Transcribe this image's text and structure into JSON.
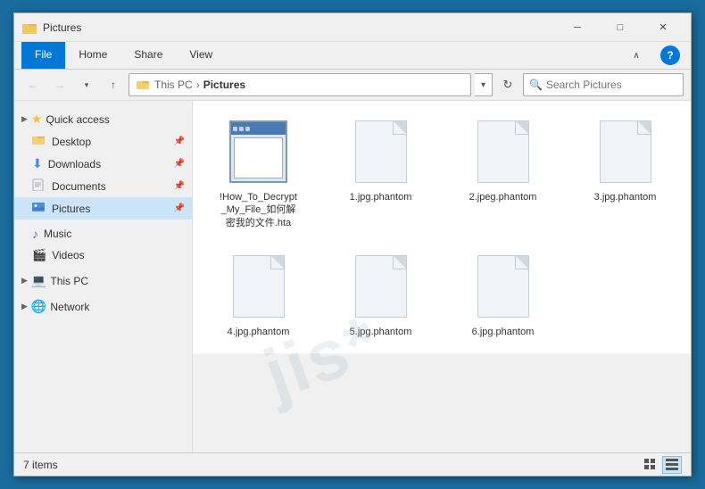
{
  "window": {
    "title": "Pictures",
    "icon": "📁"
  },
  "ribbon": {
    "tabs": [
      "File",
      "Home",
      "Share",
      "View"
    ],
    "active_tab": "File"
  },
  "address_bar": {
    "back_tooltip": "Back",
    "forward_tooltip": "Forward",
    "up_tooltip": "Up",
    "path": [
      "This PC",
      "Pictures"
    ],
    "refresh_tooltip": "Refresh",
    "search_placeholder": "Search Pictures",
    "search_value": ""
  },
  "sidebar": {
    "quick_access_label": "Quick access",
    "items": [
      {
        "label": "Desktop",
        "icon": "folder",
        "pinned": true
      },
      {
        "label": "Downloads",
        "icon": "download",
        "pinned": true
      },
      {
        "label": "Documents",
        "icon": "folder",
        "pinned": true
      },
      {
        "label": "Pictures",
        "icon": "pictures",
        "pinned": true,
        "active": true
      }
    ],
    "other_items": [
      {
        "label": "Music",
        "icon": "music"
      },
      {
        "label": "Videos",
        "icon": "video"
      }
    ],
    "this_pc_label": "This PC",
    "network_label": "Network"
  },
  "files": [
    {
      "name": "!How_To_Decrypt_My_File_如何解密我的文件.hta",
      "type": "hta",
      "id": "hta-file"
    },
    {
      "name": "1.jpg.phantom",
      "type": "doc",
      "id": "file-1"
    },
    {
      "name": "2.jpeg.phantom",
      "type": "doc",
      "id": "file-2"
    },
    {
      "name": "3.jpg.phantom",
      "type": "doc",
      "id": "file-3"
    },
    {
      "name": "4.jpg.phantom",
      "type": "doc",
      "id": "file-4"
    },
    {
      "name": "5.jpg.phantom",
      "type": "doc",
      "id": "file-5"
    },
    {
      "name": "6.jpg.phantom",
      "type": "doc",
      "id": "file-6"
    }
  ],
  "status_bar": {
    "item_count": "7 items",
    "view_icons": [
      "grid",
      "list"
    ]
  }
}
